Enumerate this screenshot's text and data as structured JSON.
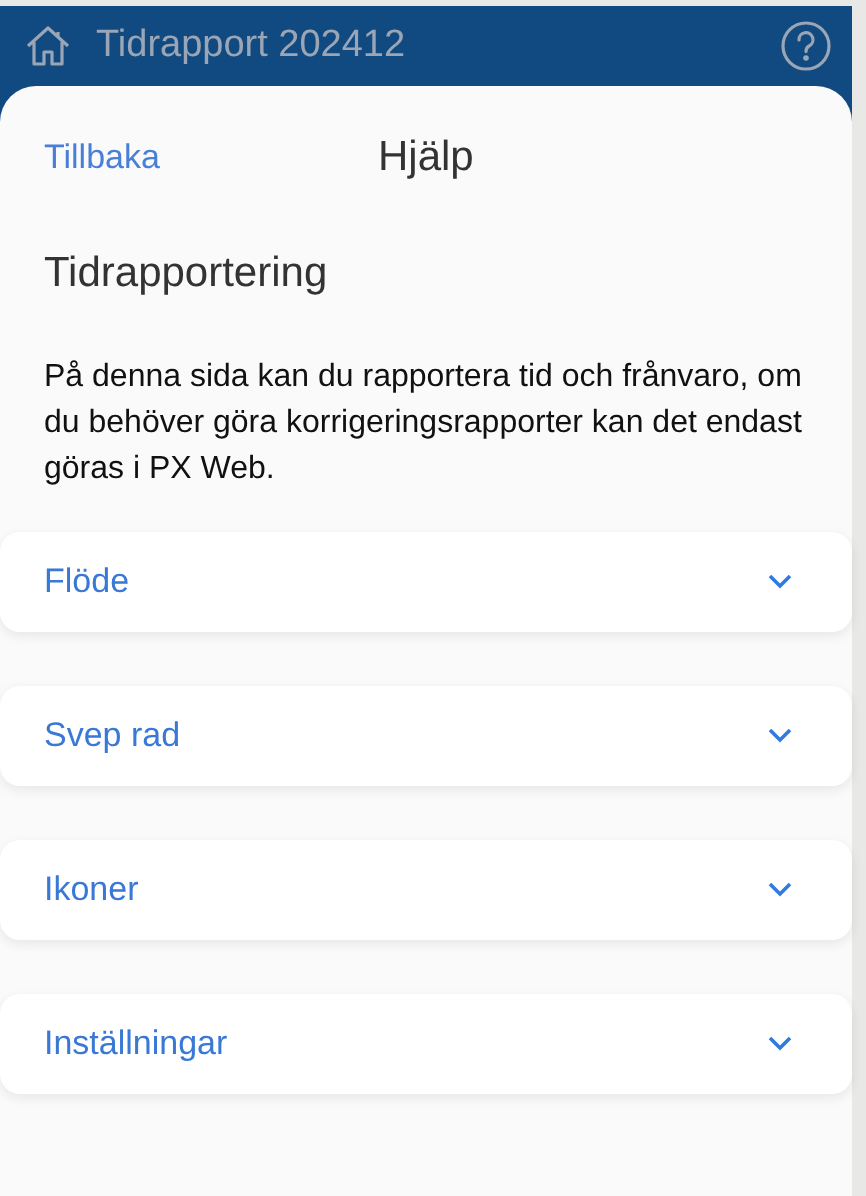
{
  "app_bar": {
    "title": "Tidrapport 202412"
  },
  "sheet": {
    "back_link": "Tillbaka",
    "title": "Hjälp",
    "heading": "Tidrapportering",
    "body": "På denna sida kan du rapportera tid och frånvaro, om du behöver göra korrigeringsrapporter kan det endast göras i PX Web."
  },
  "sections": [
    {
      "label": "Flöde",
      "expanded": false
    },
    {
      "label": "Svep rad",
      "expanded": false
    },
    {
      "label": "Ikoner",
      "expanded": false
    },
    {
      "label": "Inställningar",
      "expanded": false
    }
  ]
}
